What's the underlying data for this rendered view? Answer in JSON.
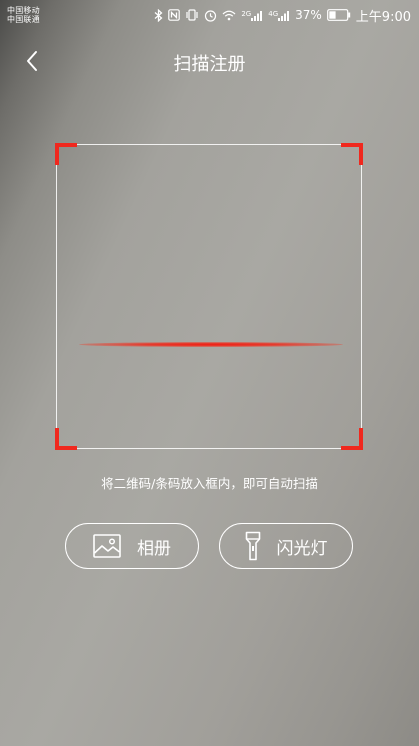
{
  "status_bar": {
    "carrier_1": "中国移动",
    "carrier_2": "中国联通",
    "icons": [
      "bluetooth-icon",
      "nfc-icon",
      "vibrate-icon",
      "alarm-icon",
      "wifi-icon",
      "signal-2g-icon",
      "signal-4g-icon",
      "battery-icon"
    ],
    "network_1": "2G",
    "network_2": "4G",
    "battery_percent": "37%",
    "battery_level": 0.37,
    "time": "上午9:00"
  },
  "header": {
    "back_icon": "chevron-left-icon",
    "title": "扫描注册"
  },
  "scanner": {
    "hint": "将二维码/条码放入框内，即可自动扫描",
    "frame_color": "#ffffff",
    "corner_color": "#f0281e",
    "scan_line_color": "#f01e14"
  },
  "actions": {
    "album": {
      "label": "相册",
      "icon": "image-icon"
    },
    "flashlight": {
      "label": "闪光灯",
      "icon": "flashlight-icon"
    }
  }
}
